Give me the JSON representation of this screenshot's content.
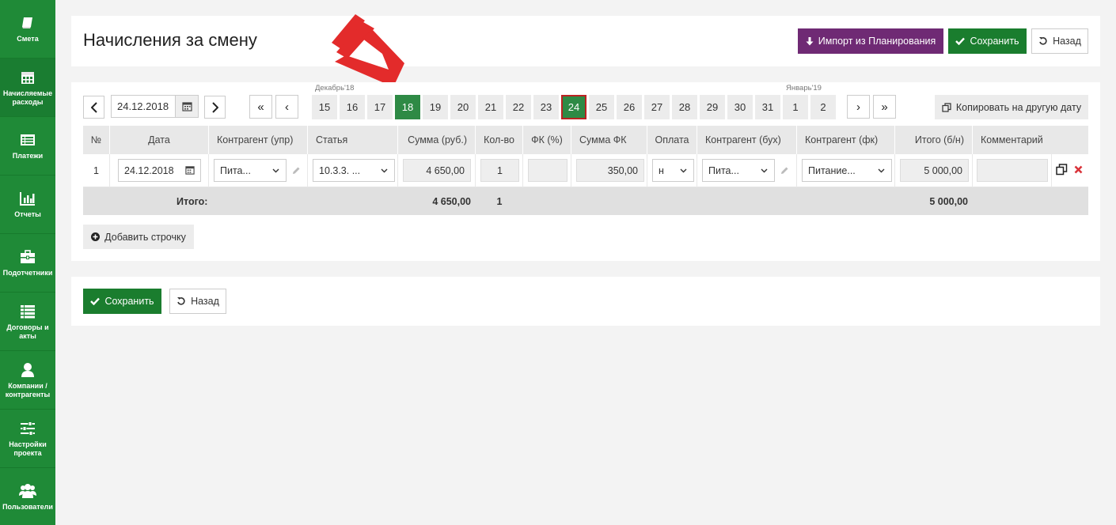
{
  "sidebar": {
    "items": [
      {
        "label": "Смета",
        "icon": "book-icon"
      },
      {
        "label": "Начисляемые расходы",
        "icon": "calendar-icon"
      },
      {
        "label": "Платежи",
        "icon": "list-icon"
      },
      {
        "label": "Отчеты",
        "icon": "bar-chart-icon"
      },
      {
        "label": "Подотчетники",
        "icon": "briefcase-icon"
      },
      {
        "label": "Договоры и акты",
        "icon": "list-bullets-icon"
      },
      {
        "label": "Компании / контрагенты",
        "icon": "user-icon"
      },
      {
        "label": "Настройки проекта",
        "icon": "sliders-icon"
      },
      {
        "label": "Пользователи",
        "icon": "users-icon"
      }
    ]
  },
  "header": {
    "title": "Начисления за смену",
    "import_label": "Импорт из Планирования",
    "save_label": "Сохранить",
    "back_label": "Назад"
  },
  "date_nav": {
    "current_date": "24.12.2018",
    "first": "«",
    "prev": "‹",
    "next": "›",
    "last": "»",
    "month1": "Декабрь'18",
    "month2": "Январь'19",
    "days": [
      "15",
      "16",
      "17",
      "18",
      "19",
      "20",
      "21",
      "22",
      "23",
      "24",
      "25",
      "26",
      "27",
      "28",
      "29",
      "30",
      "31",
      "1",
      "2"
    ],
    "selected_day": "18",
    "current_day": "24",
    "copy_label": "Копировать на другую дату"
  },
  "table": {
    "headers": [
      "№",
      "Дата",
      "Контрагент (упр)",
      "Статья",
      "Сумма (руб.)",
      "Кол-во",
      "ФК (%)",
      "Сумма ФК",
      "Оплата",
      "Контрагент (бух)",
      "Контрагент (фк)",
      "Итого (б/н)",
      "Комментарий"
    ],
    "rows": [
      {
        "num": "1",
        "date": "24.12.2018",
        "kontragent_upr": "Пита...",
        "statya": "10.3.3. ...",
        "summa": "4 650,00",
        "kolvo": "1",
        "fk": "",
        "summa_fk": "350,00",
        "oplata": "н",
        "kontragent_buh": "Пита...",
        "kontragent_fk": "Питание...",
        "itogo": "5 000,00",
        "comment": ""
      }
    ],
    "totals": {
      "label": "Итого:",
      "summa": "4 650,00",
      "kolvo": "1",
      "itogo": "5 000,00"
    },
    "add_row_label": "Добавить строчку"
  },
  "footer": {
    "save_label": "Сохранить",
    "back_label": "Назад"
  },
  "colors": {
    "sidebar": "#1f8a37",
    "purple": "#6f2a74",
    "green": "#1a7d2e",
    "arrow": "#e32b2b"
  }
}
